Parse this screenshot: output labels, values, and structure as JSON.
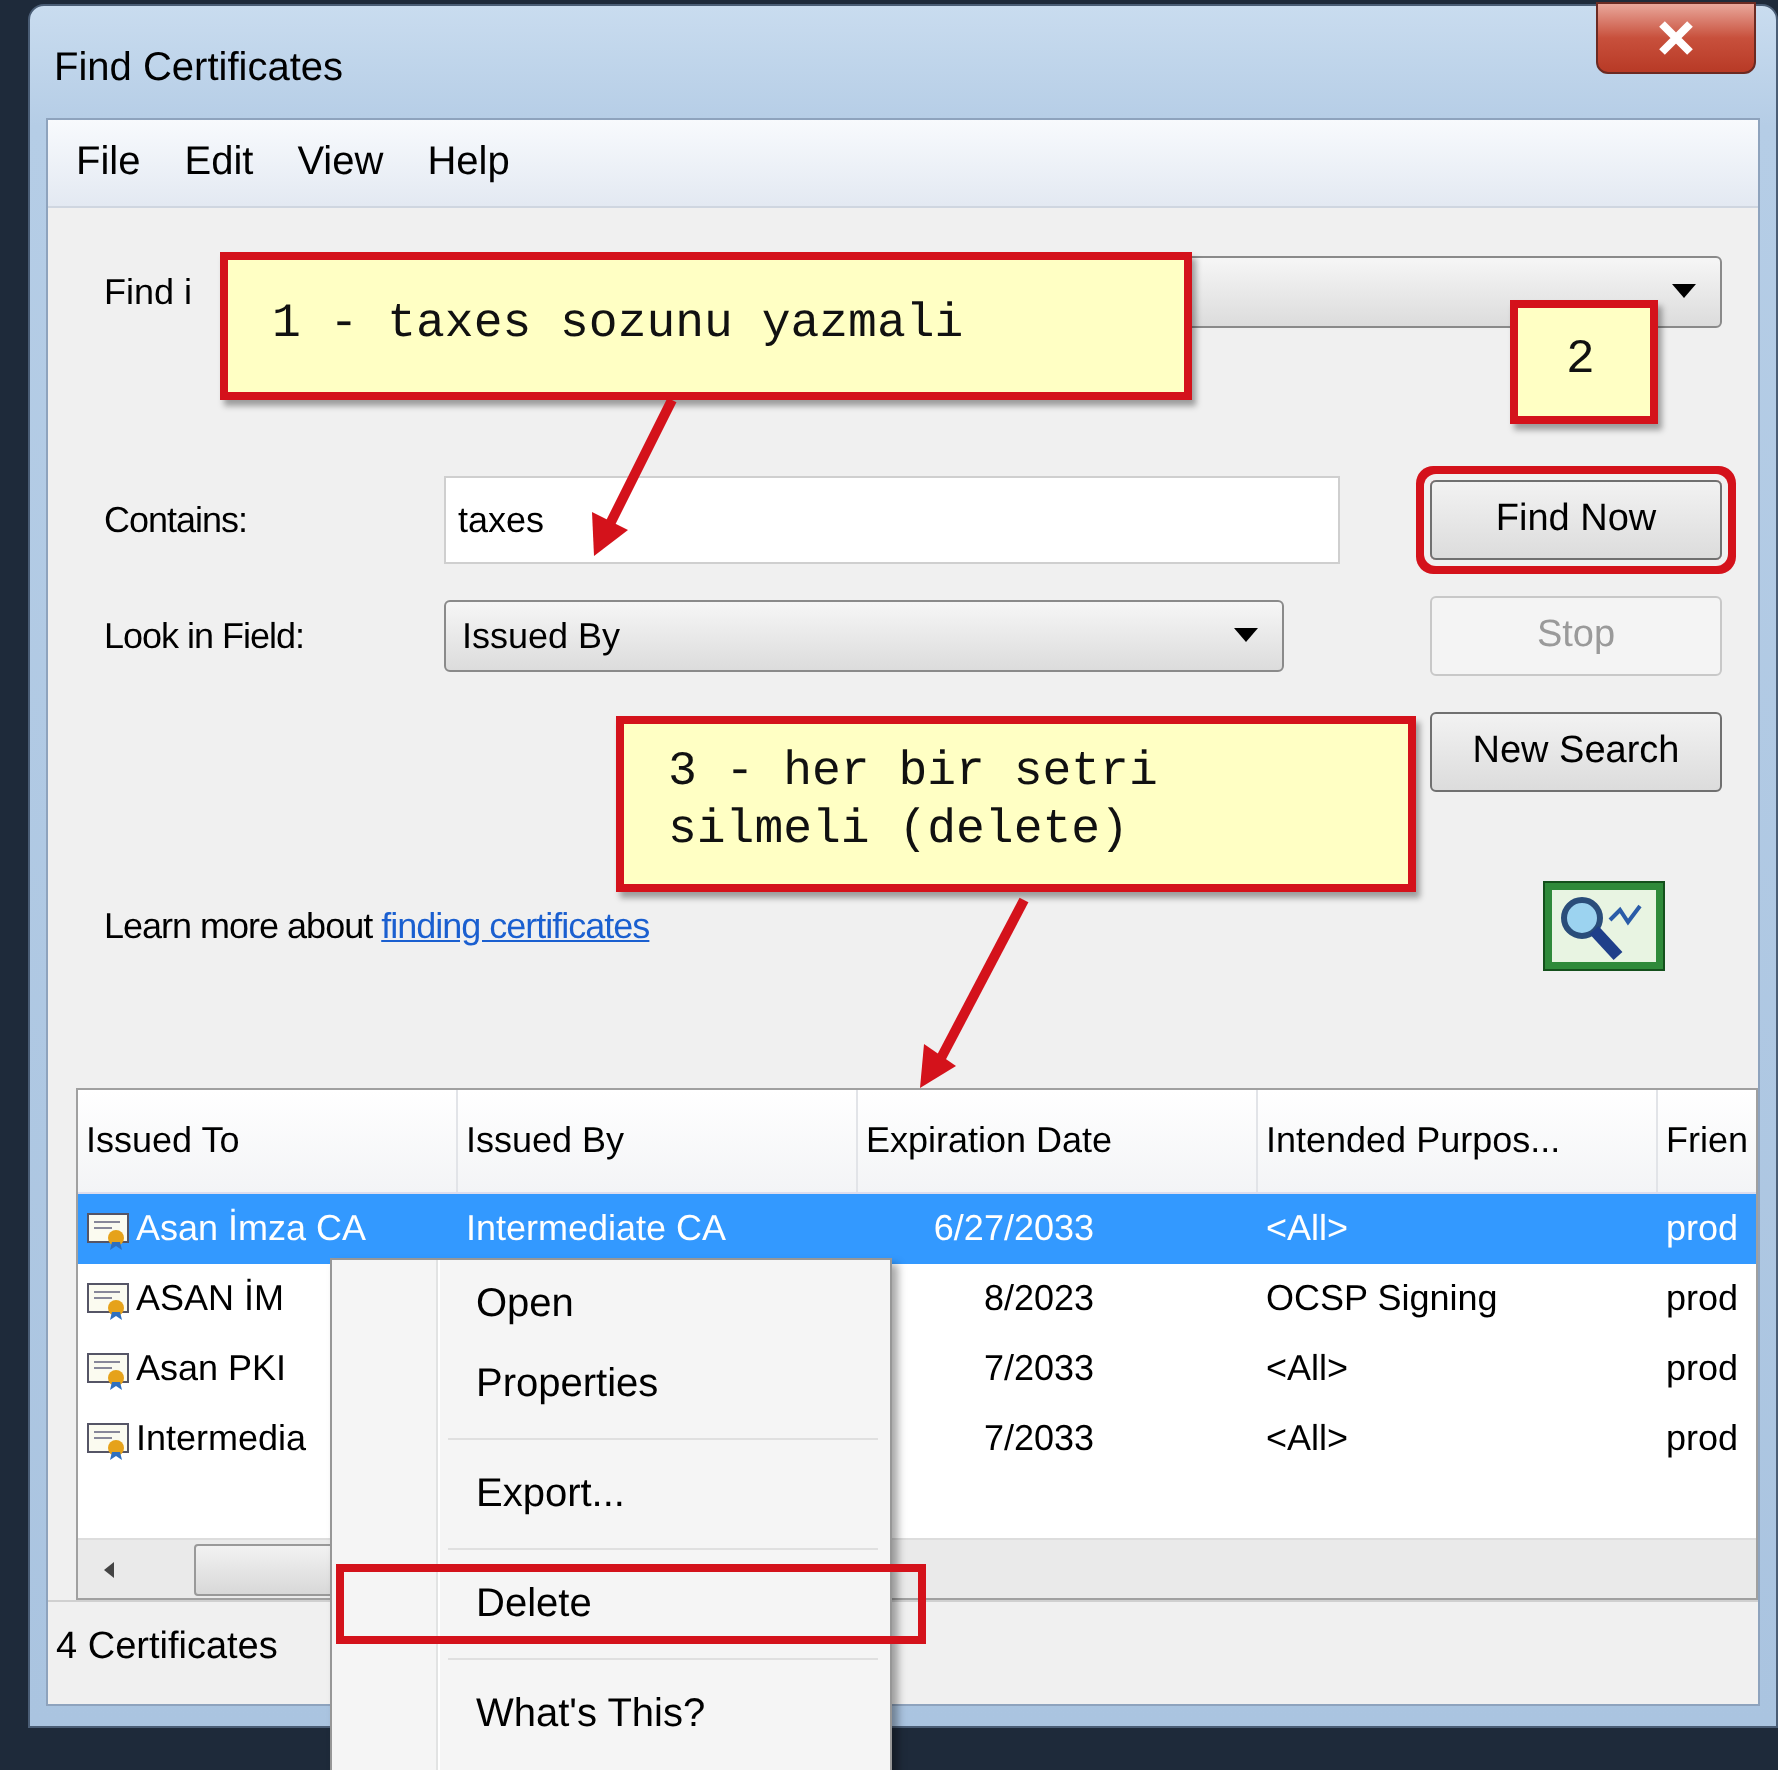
{
  "window": {
    "title": "Find Certificates"
  },
  "menu_bar": [
    "File",
    "Edit",
    "View",
    "Help"
  ],
  "find_in": {
    "label": "Find i"
  },
  "contains": {
    "label": "Contains:",
    "value": "taxes"
  },
  "look_in_field": {
    "label": "Look in Field:",
    "value": "Issued By"
  },
  "buttons": [
    {
      "label": "Find Now",
      "disabled": false,
      "annotated": true
    },
    {
      "label": "Stop",
      "disabled": true,
      "annotated": false
    },
    {
      "label": "New Search",
      "disabled": false,
      "annotated": false
    }
  ],
  "learn_more": {
    "text": "Learn more about",
    "link": "finding certificates"
  },
  "table": {
    "columns": [
      "Issued To",
      "Issued By",
      "Expiration Date",
      "Intended Purpos...",
      "Frien"
    ],
    "rows": [
      {
        "selected": true,
        "cells": [
          "Asan İmza CA",
          "Intermediate CA",
          "6/27/2033",
          "<All>",
          "prod"
        ]
      },
      {
        "selected": false,
        "cells": [
          "ASAN İM",
          "",
          "8/2023",
          "OCSP Signing",
          "prod"
        ]
      },
      {
        "selected": false,
        "cells": [
          "Asan PKI",
          "",
          "7/2033",
          "<All>",
          "prod"
        ]
      },
      {
        "selected": false,
        "cells": [
          "Intermedia",
          "",
          "7/2033",
          "<All>",
          "prod"
        ]
      }
    ]
  },
  "status_bar": "4 Certificates",
  "context_menu": [
    {
      "kind": "item",
      "label": "Open",
      "annotated": false
    },
    {
      "kind": "item",
      "label": "Properties",
      "annotated": false
    },
    {
      "kind": "separator"
    },
    {
      "kind": "item",
      "label": "Export...",
      "annotated": false
    },
    {
      "kind": "separator"
    },
    {
      "kind": "item",
      "label": "Delete",
      "annotated": true
    },
    {
      "kind": "separator"
    },
    {
      "kind": "item",
      "label": "What's This?",
      "annotated": false
    }
  ],
  "annotations": [
    {
      "text": "1 - taxes sozunu yazmali"
    },
    {
      "text": "2"
    },
    {
      "text": "3 - her bir setri\nsilmeli (delete)"
    }
  ]
}
